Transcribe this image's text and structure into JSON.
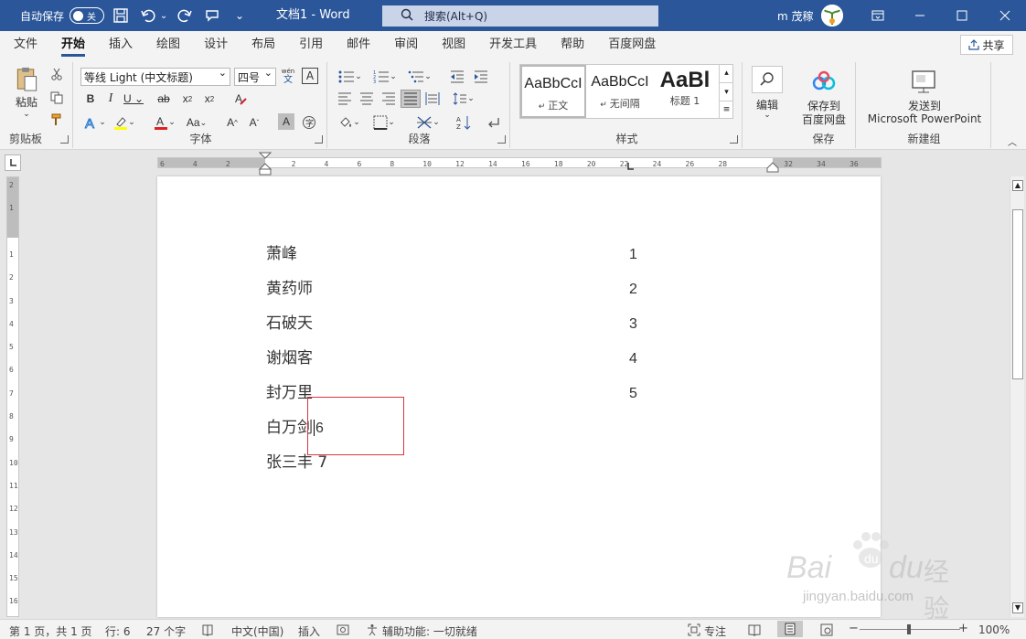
{
  "titlebar": {
    "autosave_label": "自动保存",
    "autosave_state": "关",
    "doc_title": "文档1  -  Word",
    "search_placeholder": "搜索(Alt+Q)",
    "user_name": "m 茂稼"
  },
  "tabs": [
    "文件",
    "开始",
    "插入",
    "绘图",
    "设计",
    "布局",
    "引用",
    "邮件",
    "审阅",
    "视图",
    "开发工具",
    "帮助",
    "百度网盘"
  ],
  "active_tab": "开始",
  "share_label": "共享",
  "ribbon": {
    "clipboard": {
      "paste": "粘贴",
      "label": "剪贴板"
    },
    "font": {
      "font_name": "等线 Light (中文标题)",
      "font_size": "四号",
      "label": "字体",
      "wen": "wén",
      "wen_sub": "文",
      "A_box": "A"
    },
    "paragraph": {
      "label": "段落"
    },
    "styles": {
      "label": "样式",
      "items": [
        {
          "preview": "AaBbCcI",
          "name": "正文"
        },
        {
          "preview": "AaBbCcI",
          "name": "无间隔"
        },
        {
          "preview": "AaBl",
          "name": "标题 1"
        }
      ]
    },
    "edit": {
      "label": "编辑"
    },
    "baidu": {
      "line1": "保存到",
      "line2": "百度网盘",
      "label": "保存"
    },
    "ppt": {
      "line1": "发送到",
      "line2": "Microsoft PowerPoint",
      "label": "新建组"
    }
  },
  "ruler": {
    "ticks": [
      "6",
      "4",
      "2",
      "",
      "2",
      "4",
      "6",
      "8",
      "10",
      "12",
      "14",
      "16",
      "18",
      "20",
      "22",
      "24",
      "26",
      "28",
      "",
      "32",
      "34",
      "36"
    ]
  },
  "document": {
    "rows": [
      {
        "name": "萧峰",
        "num": "1"
      },
      {
        "name": "黄药师",
        "num": "2"
      },
      {
        "name": "石破天",
        "num": "3"
      },
      {
        "name": "谢烟客",
        "num": "4"
      },
      {
        "name": "封万里",
        "num": "5"
      }
    ],
    "row6_name": "白万剑",
    "row6_num": "6",
    "row7": "张三丰 7"
  },
  "statusbar": {
    "page": "第 1 页，共 1 页",
    "line": "行: 6",
    "words": "27 个字",
    "lang": "中文(中国)",
    "mode": "插入",
    "accessibility": "辅助功能: 一切就绪",
    "focus": "专注",
    "zoom": "100%"
  },
  "watermark": {
    "brand": "Bai",
    "brand2": "du",
    "cn": "经验",
    "url": "jingyan.baidu.com"
  },
  "colors": {
    "titlebar": "#2b579a",
    "highlight": "#d9363e"
  }
}
